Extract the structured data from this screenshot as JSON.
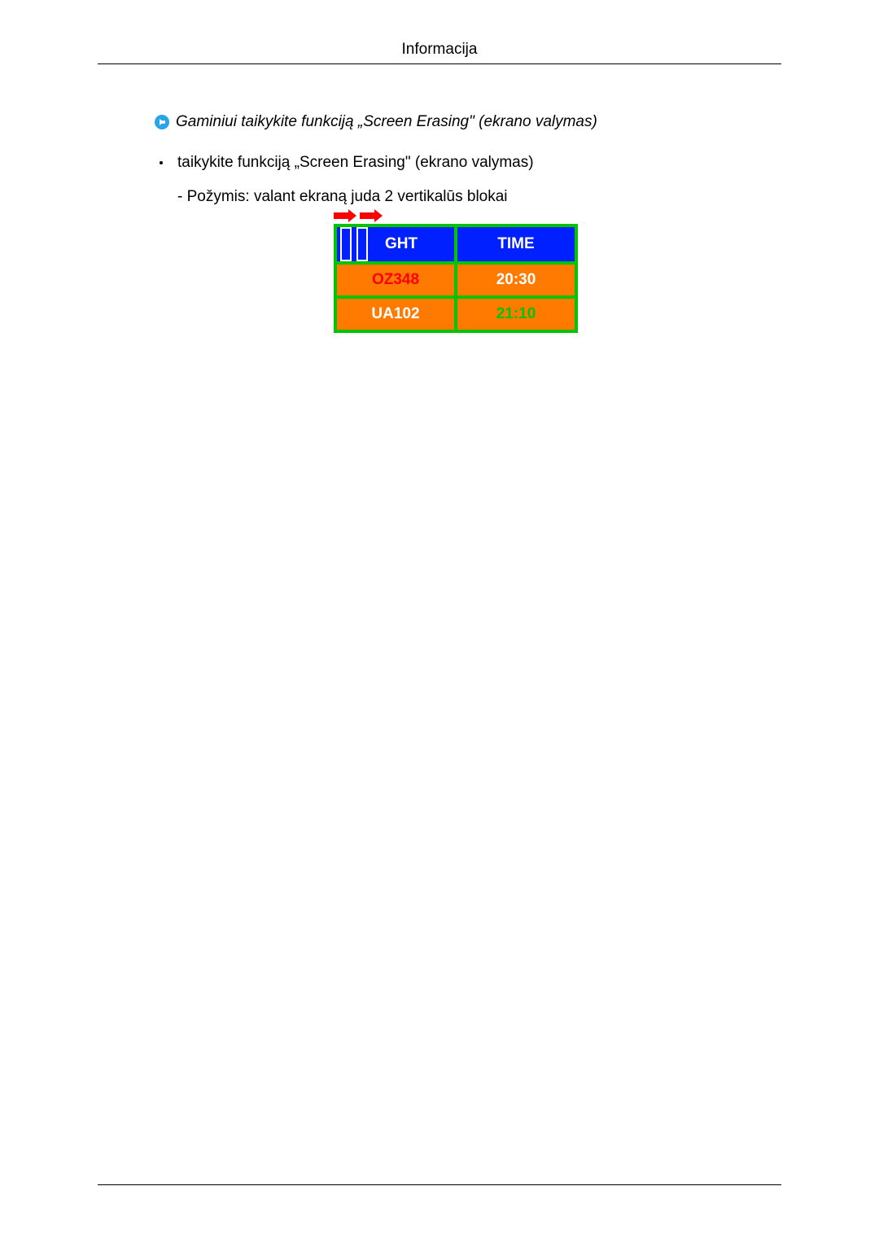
{
  "header": {
    "title": "Informacija"
  },
  "section": {
    "heading": "Gaminiui taikykite funkciją „Screen Erasing\" (ekrano valymas)",
    "bullet": "taikykite funkciją „Screen Erasing\" (ekrano valymas)",
    "subline": "- Požymis: valant ekraną juda 2 vertikalūs blokai"
  },
  "table": {
    "headers": {
      "col1_fragment": "GHT",
      "col2": "TIME"
    },
    "rows": [
      {
        "col1": "OZ348",
        "col2": "20:30"
      },
      {
        "col1": "UA102",
        "col2": "21:10"
      }
    ]
  },
  "icons": {
    "arrow_right": "arrow-right-circle-icon",
    "red_arrow": "red-arrow-right-icon"
  }
}
